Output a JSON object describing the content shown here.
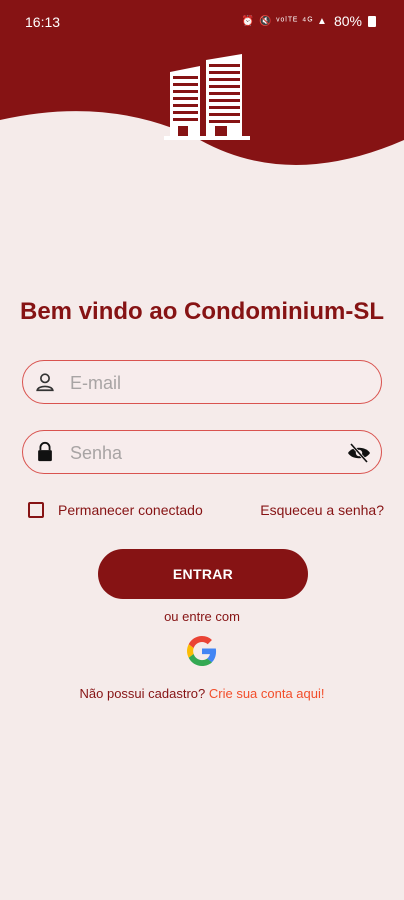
{
  "status_bar": {
    "time": "16:13",
    "icons": "⏰ 🔇 ᵛᵒˡᵀᴱ ⁴ᴳ ▲",
    "battery": "80%"
  },
  "colors": {
    "brand": "#861314",
    "background": "#f5ebea",
    "link": "#f24e2b",
    "field_border": "#d9534f"
  },
  "header": {
    "logo": "buildings-icon"
  },
  "title": "Bem vindo ao Condominium-SL",
  "email": {
    "placeholder": "E-mail",
    "icon": "user-icon"
  },
  "password": {
    "placeholder": "Senha",
    "icon": "lock-icon",
    "toggle_icon": "eye-off-icon"
  },
  "remember_label": "Permanecer conectado",
  "forgot_label": "Esqueceu a senha?",
  "enter_label": "ENTRAR",
  "or_text": "ou entre com",
  "google_icon": "google-icon",
  "signup": {
    "text": "Não possui cadastro?",
    "link": "Crie sua conta aqui!"
  }
}
